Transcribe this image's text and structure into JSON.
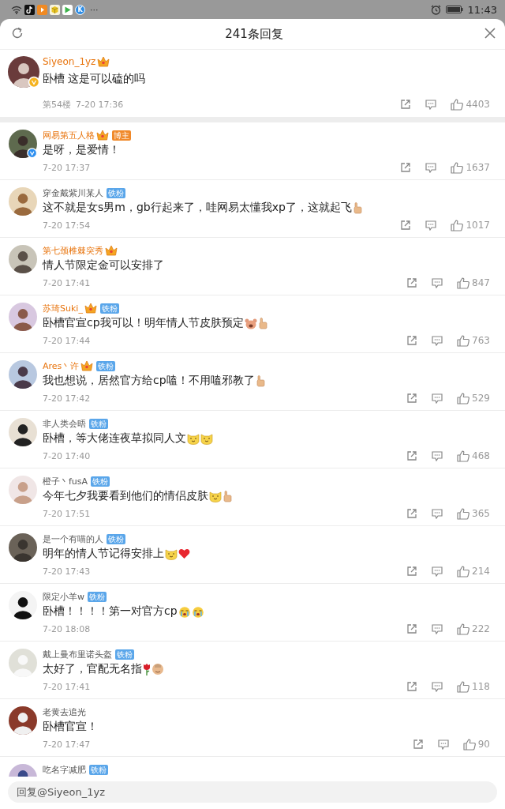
{
  "status_bar": {
    "apps": [
      {
        "kind": "tiktok"
      },
      {
        "kind": "play-orange"
      },
      {
        "kind": "cube"
      },
      {
        "kind": "play-green"
      },
      {
        "kind": "letter",
        "label": "K"
      }
    ],
    "more": "···",
    "time": "11:43"
  },
  "header": {
    "title": "241条回复"
  },
  "main_comment": {
    "name": "Siyeon_1yz",
    "vip": true,
    "verified": {
      "color": "#f5b320"
    },
    "text": "卧槽 这是可以磕的吗",
    "floor": "第54楼",
    "date": "7-20 17:36",
    "likes": "4403"
  },
  "replies": [
    {
      "name": "网易第五人格",
      "vip": true,
      "verified": {
        "color": "#2d8ff0"
      },
      "badge": {
        "kind": "host",
        "label": "博主"
      },
      "text": "是呀，是爱情！",
      "date": "7-20 17:37",
      "likes": "1637"
    },
    {
      "name": "穿金戴紫川某人",
      "vip": false,
      "badge": {
        "kind": "fan",
        "label": "铁粉"
      },
      "text": "这不就是女s男m，gb行起来了，哇网易太懂我xp了，这就起飞",
      "stickers": [
        {
          "kind": "thumbs-up"
        }
      ],
      "date": "7-20 17:54",
      "likes": "1017"
    },
    {
      "name": "第七颈椎棘突秀",
      "vip": true,
      "text": "情人节限定金可以安排了",
      "date": "7-20 17:41",
      "likes": "847"
    },
    {
      "name": "苏琦Suki_",
      "vip": true,
      "badge": {
        "kind": "fan",
        "label": "铁粉"
      },
      "text": "卧槽官宣cp我可以！明年情人节皮肤预定",
      "stickers": [
        {
          "kind": "bear"
        },
        {
          "kind": "thumbs-up"
        }
      ],
      "date": "7-20 17:44",
      "likes": "763"
    },
    {
      "name": "Ares丶许",
      "vip": true,
      "badge": {
        "kind": "fan",
        "label": "铁粉"
      },
      "text": "我也想说，居然官方给cp嗑！不用嗑邪教了",
      "stickers": [
        {
          "kind": "thumbs-up"
        }
      ],
      "date": "7-20 17:42",
      "likes": "529"
    },
    {
      "name": "非人类会晤",
      "vip": false,
      "badge": {
        "kind": "fan",
        "label": "铁粉"
      },
      "text": "卧槽，等大佬连夜草拟同人文",
      "stickers": [
        {
          "kind": "cat"
        },
        {
          "kind": "cat"
        }
      ],
      "date": "7-20 17:40",
      "likes": "468"
    },
    {
      "name": "橙子丶fusA",
      "vip": false,
      "badge": {
        "kind": "fan",
        "label": "铁粉"
      },
      "text": "今年七夕我要看到他们的情侣皮肤",
      "stickers": [
        {
          "kind": "cat"
        },
        {
          "kind": "thumbs-up"
        }
      ],
      "date": "7-20 17:51",
      "likes": "365"
    },
    {
      "name": "是一个有喵的人",
      "vip": false,
      "badge": {
        "kind": "fan",
        "label": "铁粉"
      },
      "text": "明年的情人节记得安排上",
      "stickers": [
        {
          "kind": "cat"
        },
        {
          "kind": "heart"
        }
      ],
      "date": "7-20 17:43",
      "likes": "214"
    },
    {
      "name": "限定小羊w",
      "vip": false,
      "badge": {
        "kind": "fan",
        "label": "铁粉"
      },
      "text": "卧槽！！！！第一对官方cp",
      "stickers": [
        {
          "kind": "cry"
        },
        {
          "kind": "cry"
        }
      ],
      "date": "7-20 18:08",
      "likes": "222"
    },
    {
      "name": "戴上曼布里诺头盔",
      "vip": false,
      "badge": {
        "kind": "fan",
        "label": "铁粉"
      },
      "text": "太好了，官配无名指",
      "stickers": [
        {
          "kind": "rose"
        },
        {
          "kind": "face"
        }
      ],
      "date": "7-20 17:41",
      "likes": "118"
    },
    {
      "name": "老黄去追光",
      "vip": false,
      "text": "卧槽官宣！",
      "date": "7-20 17:47",
      "likes": "90"
    },
    {
      "name": "吃名字减肥",
      "vip": false,
      "badge": {
        "kind": "fan",
        "label": "铁粉"
      }
    }
  ],
  "reply_box": {
    "placeholder": "回复@Siyeon_1yz"
  }
}
